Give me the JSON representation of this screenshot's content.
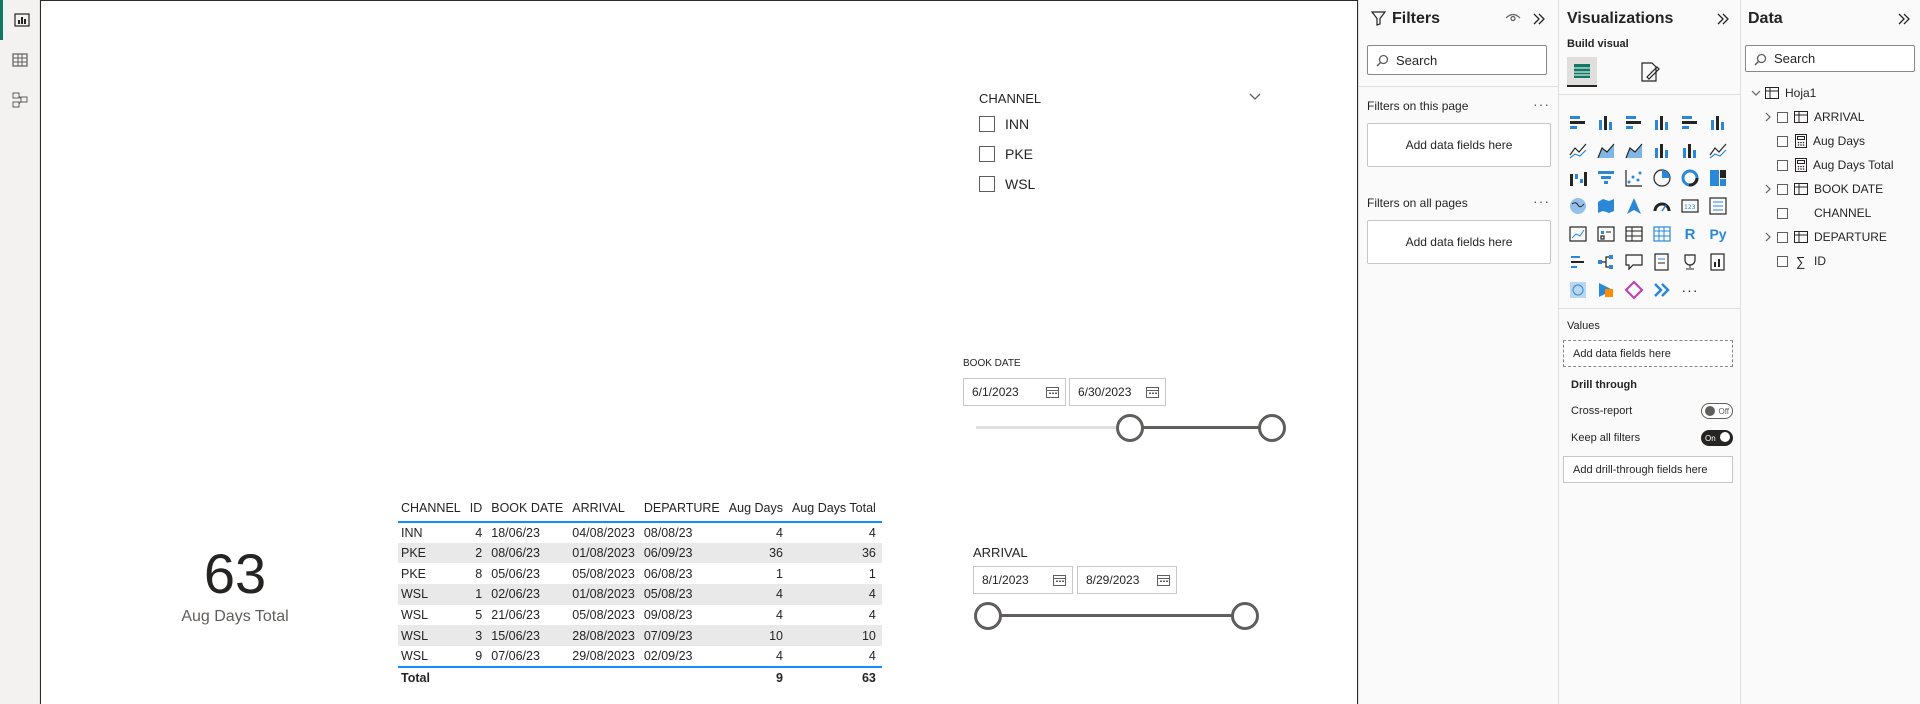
{
  "rail": {
    "items": [
      "report-view",
      "table-view",
      "model-view"
    ]
  },
  "channel_slicer": {
    "title": "CHANNEL",
    "options": [
      "INN",
      "PKE",
      "WSL"
    ]
  },
  "book_date_slicer": {
    "title": "BOOK DATE",
    "start": "6/1/2023",
    "end": "6/30/2023"
  },
  "arrival_slicer": {
    "title": "ARRIVAL",
    "start": "8/1/2023",
    "end": "8/29/2023"
  },
  "card": {
    "value": "63",
    "label": "Aug Days Total"
  },
  "table": {
    "headers": [
      "CHANNEL",
      "ID",
      "BOOK DATE",
      "ARRIVAL",
      "DEPARTURE",
      "Aug Days",
      "Aug Days Total"
    ],
    "rows": [
      [
        "INN",
        "4",
        "18/06/23",
        "04/08/2023",
        "08/08/23",
        "4",
        "4"
      ],
      [
        "PKE",
        "2",
        "08/06/23",
        "01/08/2023",
        "06/09/23",
        "36",
        "36"
      ],
      [
        "PKE",
        "8",
        "05/06/23",
        "05/08/2023",
        "06/08/23",
        "1",
        "1"
      ],
      [
        "WSL",
        "1",
        "02/06/23",
        "01/08/2023",
        "05/08/23",
        "4",
        "4"
      ],
      [
        "WSL",
        "5",
        "21/06/23",
        "05/08/2023",
        "09/08/23",
        "4",
        "4"
      ],
      [
        "WSL",
        "3",
        "15/06/23",
        "28/08/2023",
        "07/09/23",
        "10",
        "10"
      ],
      [
        "WSL",
        "9",
        "07/06/23",
        "29/08/2023",
        "02/09/23",
        "4",
        "4"
      ]
    ],
    "total": [
      "Total",
      "",
      "",
      "",
      "",
      "9",
      "63"
    ]
  },
  "filters": {
    "title": "Filters",
    "search_placeholder": "Search",
    "on_page_label": "Filters on this page",
    "on_all_label": "Filters on all pages",
    "add_fields": "Add data fields here"
  },
  "visualizations": {
    "title": "Visualizations",
    "build_visual": "Build visual",
    "values_label": "Values",
    "values_drop": "Add data fields here",
    "drill_title": "Drill through",
    "cross_report": "Cross-report",
    "cross_report_state": "Off",
    "keep_filters": "Keep all filters",
    "keep_filters_state": "On",
    "drill_drop": "Add drill-through fields here",
    "icons": [
      "stacked-bar-icon",
      "stacked-column-icon",
      "clustered-bar-icon",
      "clustered-column-icon",
      "100-stacked-bar-icon",
      "100-stacked-column-icon",
      "line-chart-icon",
      "area-chart-icon",
      "stacked-area-icon",
      "line-column-icon",
      "line-clustered-column-icon",
      "ribbon-chart-icon",
      "waterfall-icon",
      "funnel-icon",
      "scatter-icon",
      "pie-icon",
      "donut-icon",
      "treemap-icon",
      "map-icon",
      "filled-map-icon",
      "azure-map-icon",
      "gauge-icon",
      "card-icon",
      "multirow-card-icon",
      "kpi-icon",
      "slicer-icon",
      "table-icon",
      "matrix-icon",
      "r-visual-icon",
      "python-visual-icon",
      "key-influencers-icon",
      "decomposition-tree-icon",
      "qa-icon",
      "smart-narrative-icon",
      "metrics-icon",
      "paginated-report-icon",
      "arcgis-icon",
      "power-apps-icon",
      "power-automate-icon",
      "chevron-visual-icon",
      "more-visuals-icon"
    ],
    "r_label": "R",
    "py_label": "Py"
  },
  "data_pane": {
    "title": "Data",
    "search_placeholder": "Search",
    "table_name": "Hoja1",
    "fields": [
      {
        "name": "ARRIVAL",
        "kind": "date-hierarchy",
        "expandable": true
      },
      {
        "name": "Aug Days",
        "kind": "measure",
        "expandable": false
      },
      {
        "name": "Aug Days Total",
        "kind": "measure",
        "expandable": false
      },
      {
        "name": "BOOK DATE",
        "kind": "date-hierarchy",
        "expandable": true
      },
      {
        "name": "CHANNEL",
        "kind": "text",
        "expandable": false
      },
      {
        "name": "DEPARTURE",
        "kind": "date-hierarchy",
        "expandable": true
      },
      {
        "name": "ID",
        "kind": "sum",
        "expandable": false
      }
    ]
  },
  "colors": {
    "accent": "#118dff",
    "rail_active": "#117865",
    "alt_row": "#e9e9e9"
  }
}
